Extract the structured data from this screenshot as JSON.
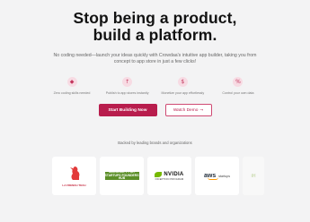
{
  "hero": {
    "title_line1": "Stop being a product,",
    "title_line2": "build a platform.",
    "subtitle": "No coding needed—launch your ideas quickly with Crowdaa's intuitive app builder, taking you from concept to app store in just a few clicks!"
  },
  "features": [
    {
      "label": "Zero coding skills needed",
      "icon": "code-icon"
    },
    {
      "label": "Publish to app stores instantly",
      "icon": "upload-icon"
    },
    {
      "label": "Monetize your app effortlessly",
      "icon": "dollar-icon"
    },
    {
      "label": "Control your own data",
      "icon": "percent-icon"
    }
  ],
  "cta": {
    "primary_label": "Start Building Now",
    "secondary_label": "Watch Demo",
    "secondary_arrow": "→"
  },
  "backed": {
    "label": "Backed by leading brands and organizations"
  },
  "logos": {
    "frenchtech": "LA FRENCH TECH",
    "microsoft_line1": "MICROSOFT FOR",
    "microsoft_line2": "STARTUPS FOUNDERS HUB",
    "nvidia_name": "NVIDIA",
    "nvidia_sub": "INCEPTION PROGRAM",
    "aws_name": "aws",
    "aws_sub": "startups",
    "partial": "iH"
  },
  "colors": {
    "accent": "#b81d4d",
    "background": "#f3f3f4",
    "icon_bg": "#f7dbe3"
  }
}
